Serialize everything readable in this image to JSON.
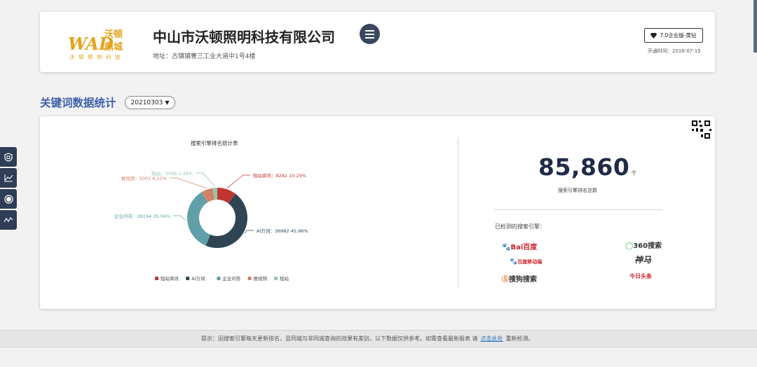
{
  "company": {
    "logo_text": "WAD",
    "logo_cn": "沃顿",
    "logo_cn2": "鼎城",
    "logo_sub": "沃顿照明科技",
    "name": "中山市沃顿照明科技有限公司",
    "address": "地址：古镇镇曹三工业大道中1号4楼",
    "version": "7.0企业版-黄钻",
    "open_date": "开通时间：2016-07-15"
  },
  "section": {
    "title": "关键词数据统计",
    "date_selected": "20210303"
  },
  "chart_data": {
    "type": "pie",
    "title": "搜索引擎排名统计表",
    "slices": [
      {
        "name": "短站商讯",
        "value": 8282,
        "percent": "10.29%",
        "color": "#c23531"
      },
      {
        "name": "AI万词",
        "value": 36982,
        "percent": "45.96%",
        "color": "#2f4554"
      },
      {
        "name": "企业问答",
        "value": 28194,
        "percent": "35.04%",
        "color": "#61a0a8"
      },
      {
        "name": "推视频",
        "value": 5001,
        "percent": "6.22%",
        "color": "#d48265"
      },
      {
        "name": "短站",
        "value": 2006,
        "percent": "2.49%",
        "color": "#91c7ae"
      }
    ],
    "legend": [
      "短站商讯",
      "AI万词",
      "企业问答",
      "推视频",
      "短站"
    ],
    "legend_position": "bottom"
  },
  "stats": {
    "total": "85,860",
    "unit": "个",
    "total_label": "搜索引擎排名总数",
    "engines_label": "已检测的搜索引擎：",
    "engines": [
      "Bai百度",
      "360搜索",
      "百度移动端",
      "神马",
      "搜狗搜索",
      "今日头条"
    ]
  },
  "footer": {
    "notice": "提示：因搜索引擎每天更新排名，且同城与非同城查询的效果有差别，以下数据仅供参考。如需查看最新报表 请",
    "link": "点击此处",
    "tail": "重新检测。"
  },
  "sidebar": {
    "icons": [
      "shield-icon",
      "line-chart-icon",
      "circle-icon",
      "trend-icon"
    ]
  }
}
